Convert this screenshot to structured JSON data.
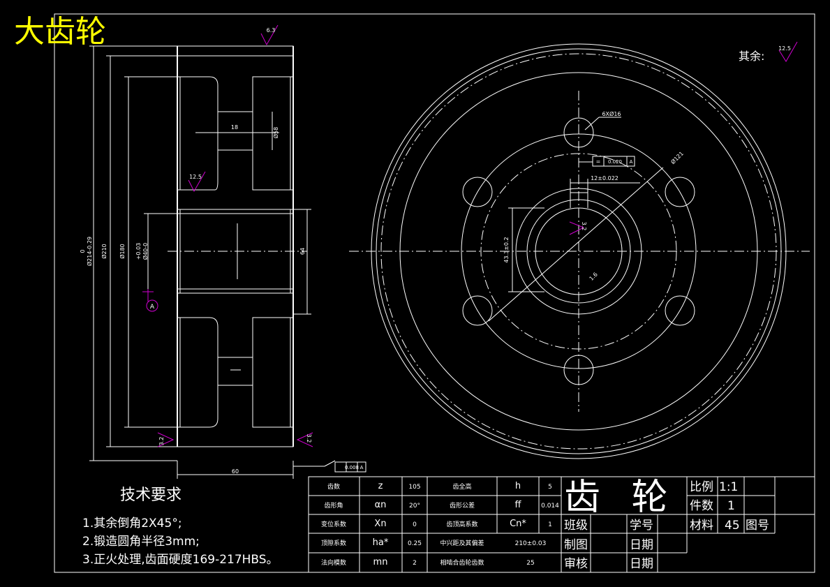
{
  "title": "大齿轮",
  "other_roughness": {
    "label": "其余:",
    "value": "12.5"
  },
  "roughness": {
    "top": "6.3",
    "web": "12.5",
    "bl": "3.2",
    "br": "3.2",
    "bore": "3.2"
  },
  "section_dims": {
    "d_root": "0\nØ214-0.29",
    "d_210": "Ø210",
    "d_180": "Ø180",
    "bore": "+0.03\nØ40-0",
    "hole_w": "18",
    "hole_d": "Ø58",
    "hub_len": "64",
    "width": "60",
    "datum": "A"
  },
  "runout_tol": "0.008",
  "runout_datum": "A",
  "front_view": {
    "holes_label": "6XØ16",
    "flat_tol": "0.020",
    "flat_datum": "A",
    "pcd": "Ø121",
    "keyway_w": "12±0.022",
    "keyway_h": "43.3±0.2",
    "chamfer": "1.6",
    "bore_rough": "3.2"
  },
  "tech_req": {
    "heading": "技术要求",
    "items": [
      "1.其余倒角2X45°;",
      "2.锻造圆角半径3mm;",
      "3.正火处理,齿面硬度169-217HBS。"
    ]
  },
  "params": [
    {
      "name": "齿数",
      "sym": "z",
      "val": "105",
      "name2": "齿全高",
      "sym2": "h",
      "val2": "5"
    },
    {
      "name": "齿形角",
      "sym": "αn",
      "val": "20°",
      "name2": "齿形公差",
      "sym2": "ff",
      "val2": "0.014"
    },
    {
      "name": "变位系数",
      "sym": "Xn",
      "val": "0",
      "name2": "齿顶高系数",
      "sym2": "Cn*",
      "val2": "1"
    },
    {
      "name": "顶隙系数",
      "sym": "ha*",
      "val": "0.25",
      "name2": "中兴距及其偏差",
      "sym2": "",
      "val2": "210±0.03"
    },
    {
      "name": "法向模数",
      "sym": "mn",
      "val": "2",
      "name2": "相啮合齿轮齿数",
      "sym2": "",
      "val2": "25"
    }
  ],
  "title_block": {
    "part_name": "齿  轮",
    "scale_label": "比例",
    "scale": "1:1",
    "qty_label": "件数",
    "qty": "1",
    "class_label": "班级",
    "id_label": "学号",
    "material_label": "材料",
    "material": "45",
    "drawing_no_label": "图号",
    "drawn_label": "制图",
    "date_label": "日期",
    "check_label": "审核",
    "date2_label": "日期"
  }
}
